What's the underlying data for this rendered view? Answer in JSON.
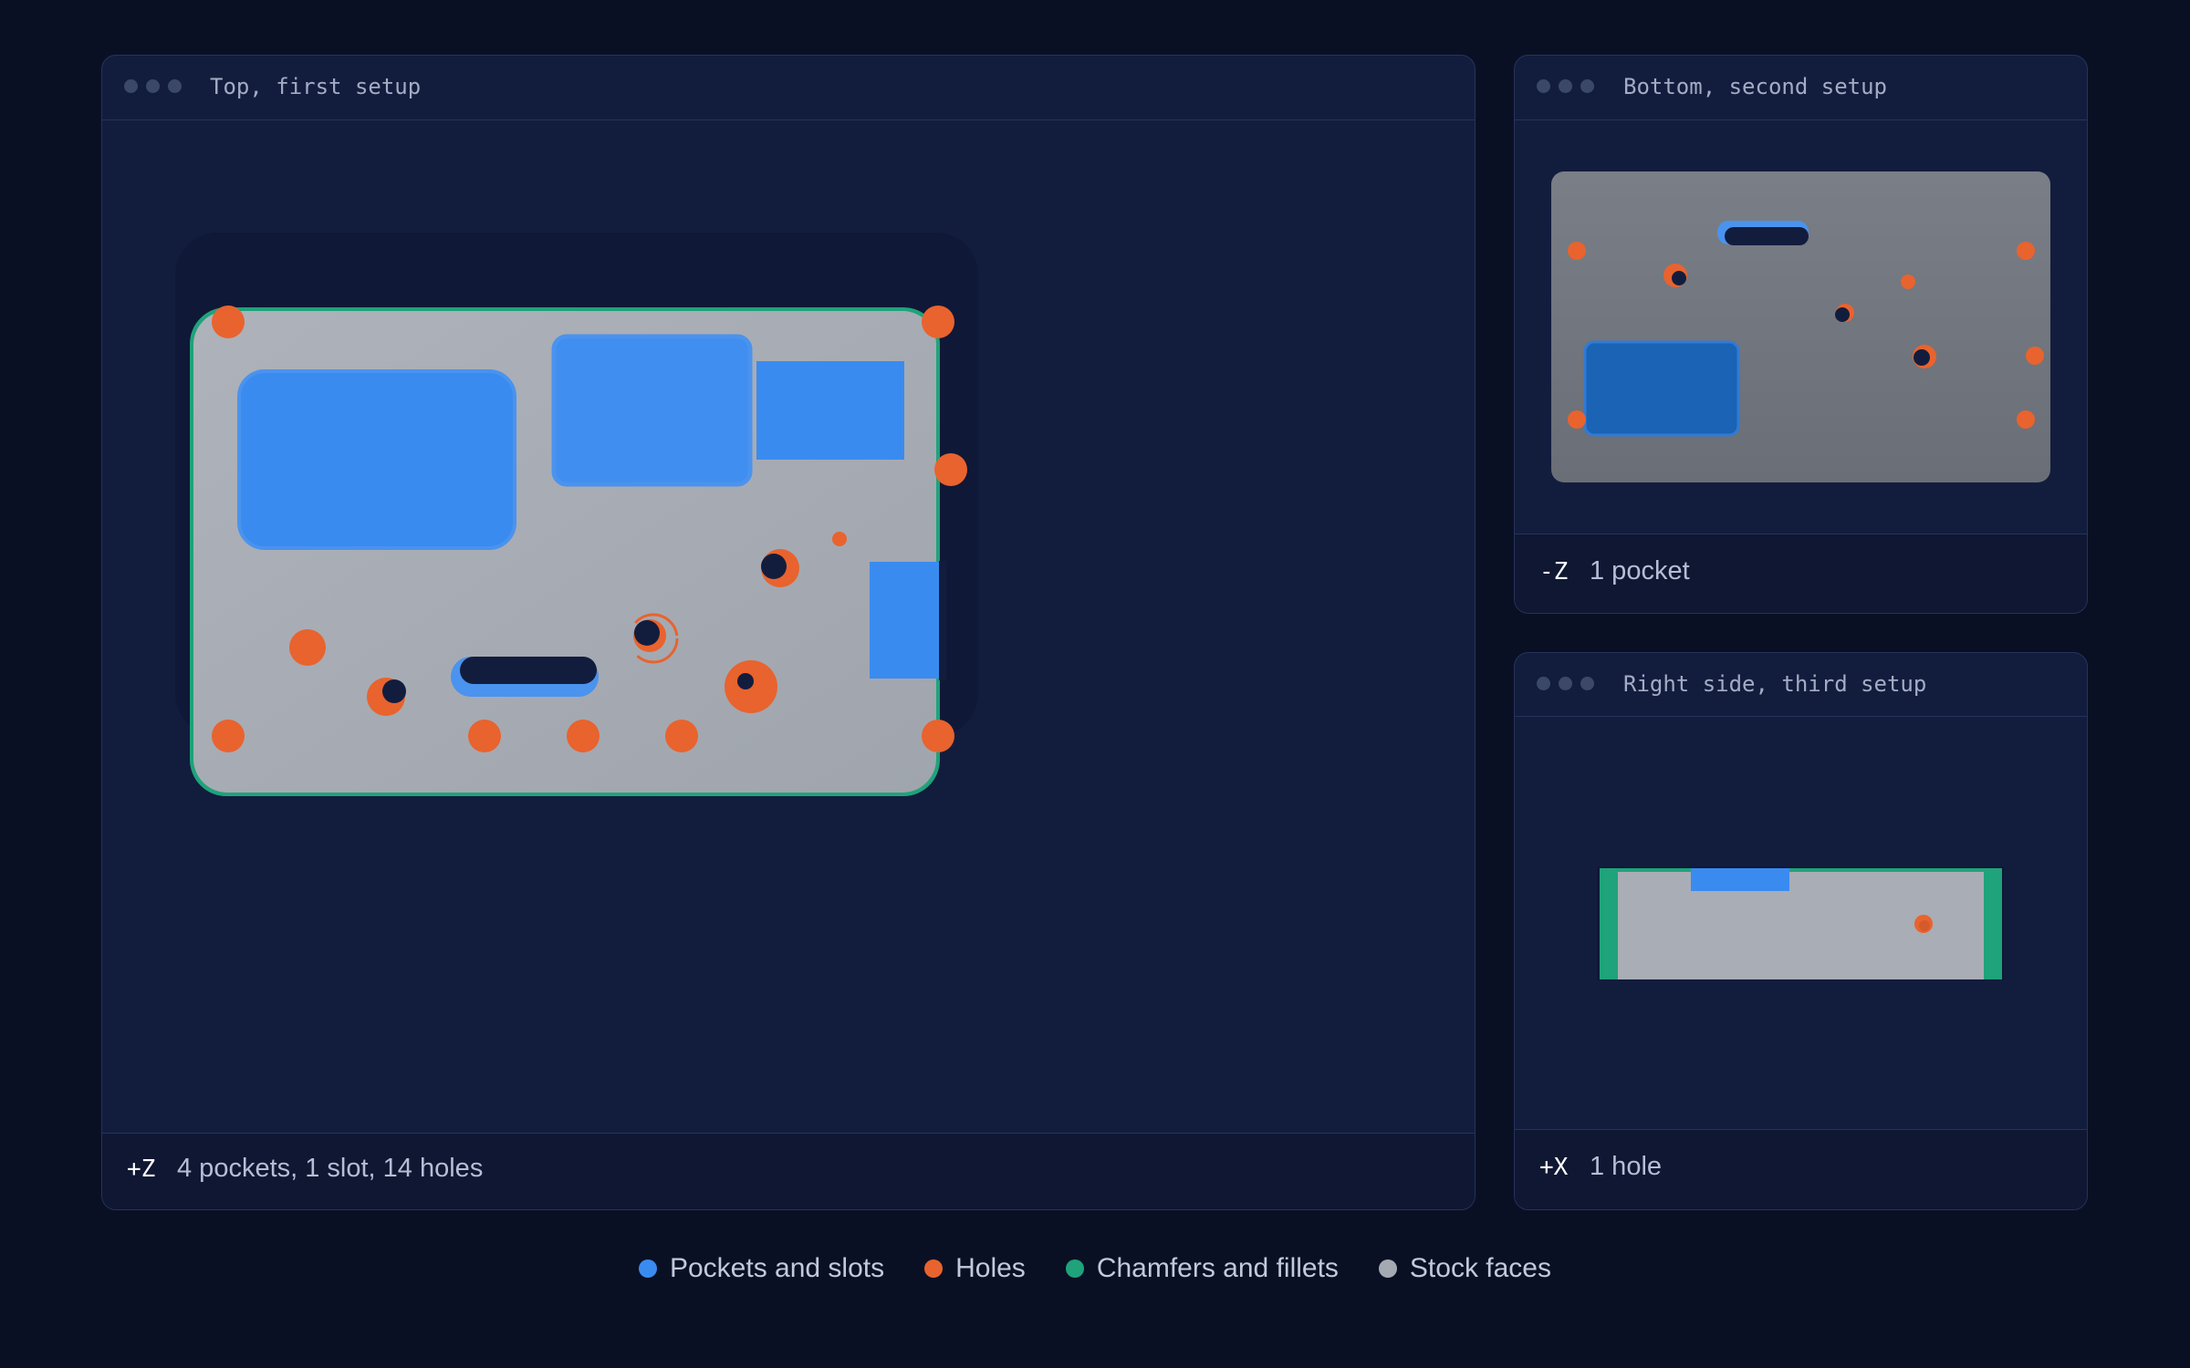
{
  "colors": {
    "pockets": "#3a8bf0",
    "holes": "#e8632e",
    "chamfers": "#1fa37a",
    "stock": "#a5aab2"
  },
  "views": {
    "top": {
      "title": "Top, first setup",
      "axis": "+Z",
      "summary": "4 pockets, 1 slot, 14 holes"
    },
    "bottom": {
      "title": "Bottom, second setup",
      "axis": "-Z",
      "summary": "1 pocket"
    },
    "right": {
      "title": "Right side, third setup",
      "axis": "+X",
      "summary": "1 hole"
    }
  },
  "legend": [
    {
      "label": "Pockets and slots",
      "color": "#3a8bf0"
    },
    {
      "label": "Holes",
      "color": "#e8632e"
    },
    {
      "label": "Chamfers and fillets",
      "color": "#1fa37a"
    },
    {
      "label": "Stock faces",
      "color": "#a5aab2"
    }
  ]
}
